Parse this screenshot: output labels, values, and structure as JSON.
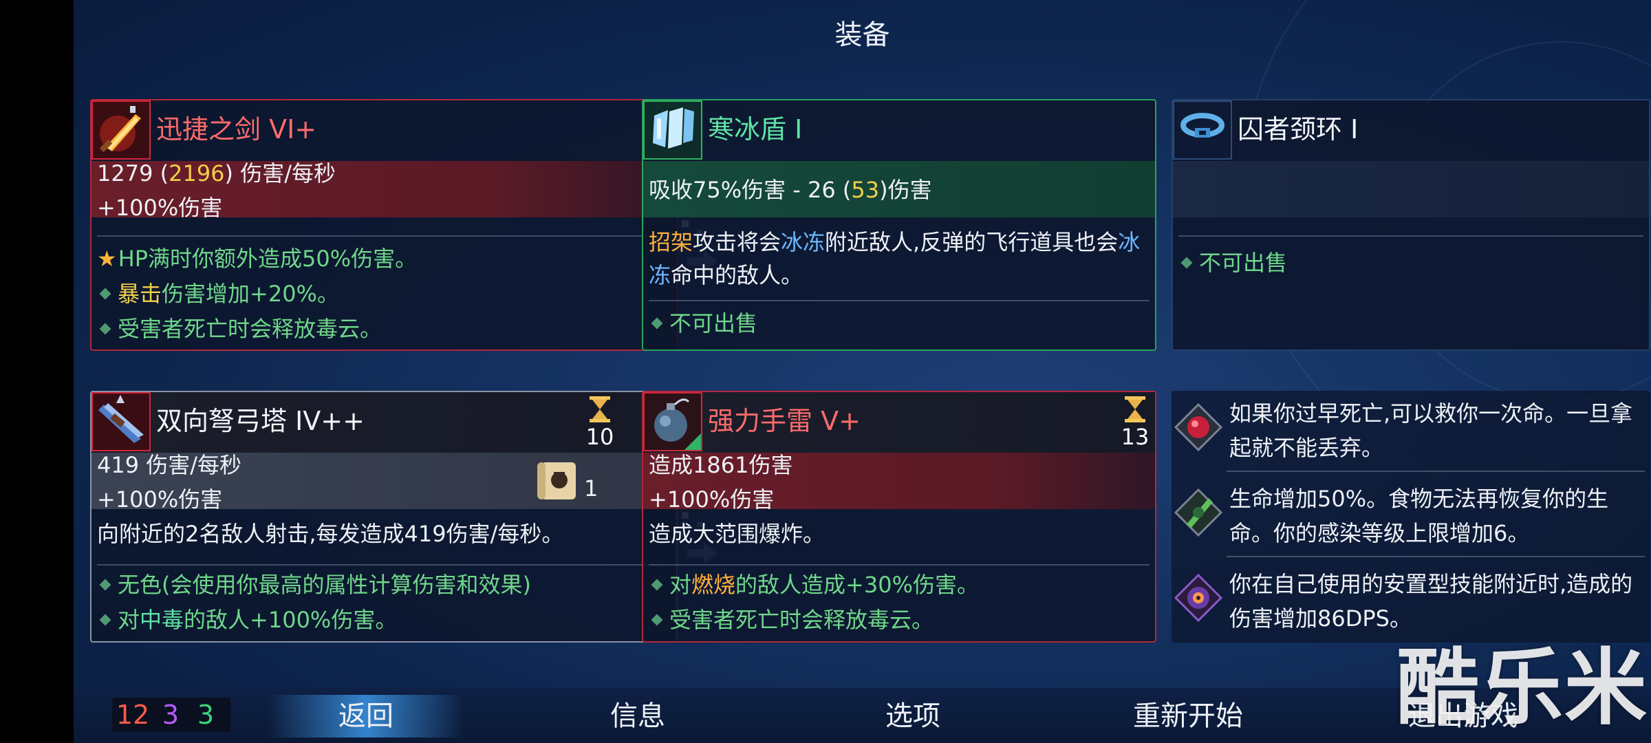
{
  "header": {
    "title": "装备"
  },
  "weapon1": {
    "name": "迅捷之剑 VI+",
    "dps_prefix": "1279 (",
    "dps_crit": "2196",
    "dps_suffix": ") 伤害/每秒",
    "bonus": "+100%伤害",
    "affix1": "HP满时你额外造成50%伤害。",
    "affix2_kw": "暴击",
    "affix2_rest": "伤害增加+20%。",
    "affix3": "受害者死亡时会释放毒云。"
  },
  "shield": {
    "name": "寒冰盾 I",
    "block_prefix": "吸收75%伤害 - 26 (",
    "block_crit": "53",
    "block_suffix": ")伤害",
    "desc_kw1": "招架",
    "desc_t1": "攻击将会",
    "desc_kw2": "冰冻",
    "desc_t2": "附近敌人,反弹的飞行道具也会",
    "desc_kw3": "冰冻",
    "desc_t3": "命中的敌人。",
    "affix1": "不可出售"
  },
  "amulet": {
    "name": "囚者颈环 I",
    "affix1": "不可出售"
  },
  "skill1": {
    "name": "双向弩弓塔 IV++",
    "cooldown": "10",
    "dps": "419 伤害/每秒",
    "bonus": "+100%伤害",
    "scroll_count": "1",
    "desc": "向附近的2名敌人射击,每发造成419伤害/每秒。",
    "affix1": "无色(会使用你最高的属性计算伤害和效果)",
    "affix2_a": "对",
    "affix2_kw": "中毒",
    "affix2_b": "的敌人+100%伤害。"
  },
  "skill2": {
    "name": "强力手雷 V+",
    "cooldown": "13",
    "damage": "造成1861伤害",
    "bonus": "+100%伤害",
    "desc": "造成大范围爆炸。",
    "affix1_a": "对",
    "affix1_kw": "燃烧",
    "affix1_b": "的敌人造成+30%伤害。",
    "affix2": "受害者死亡时会释放毒云。"
  },
  "mutations": [
    {
      "icon": "heart-shield-icon",
      "text": "如果你过早死亡,可以救你一次命。一旦拿起就不能丢弃。"
    },
    {
      "icon": "green-blade-icon",
      "text": "生命增加50%。食物无法再恢复你的生命。你的感染等级上限增加6。"
    },
    {
      "icon": "purple-eye-icon",
      "text": "你在自己使用的安置型技能附近时,造成的伤害增加86DPS。"
    }
  ],
  "bottom": {
    "scroll_red": "12",
    "scroll_purple": "3",
    "scroll_green": "3",
    "back": "返回",
    "info": "信息",
    "options": "选项",
    "restart": "重新开始",
    "quit": "退出游戏"
  },
  "watermark": "酷乐米",
  "colors": {
    "brutality": "#ff5a4a",
    "tactics": "#b45cff",
    "survival": "#3fd47a",
    "background": "#13305e"
  }
}
